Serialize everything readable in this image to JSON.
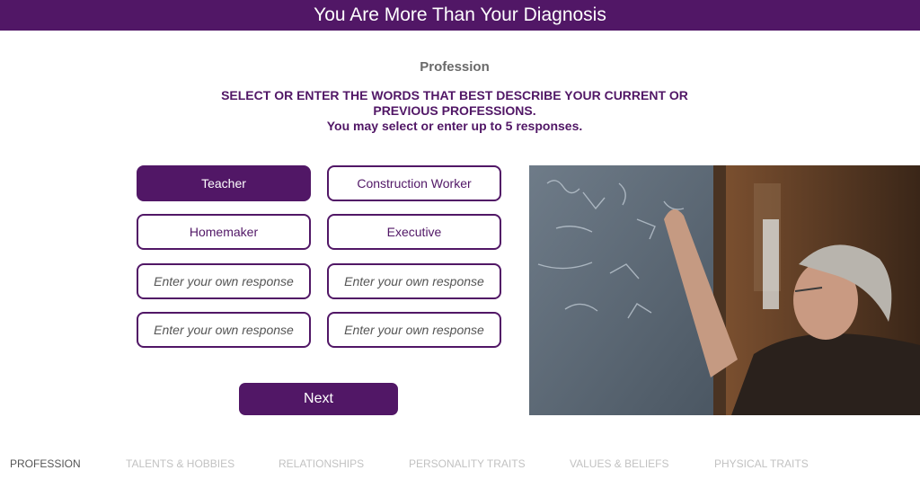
{
  "header": {
    "title": "You Are More Than Your Diagnosis"
  },
  "section": {
    "title": "Profession",
    "instruction": "SELECT OR ENTER THE WORDS THAT BEST DESCRIBE YOUR CURRENT OR PREVIOUS PROFESSIONS.",
    "hint": "You may select or enter up to 5 responses."
  },
  "options": [
    {
      "label": "Teacher",
      "selected": true
    },
    {
      "label": "Construction Worker",
      "selected": false
    },
    {
      "label": "Homemaker",
      "selected": false
    },
    {
      "label": "Executive",
      "selected": false
    }
  ],
  "custom_inputs": {
    "placeholder": "Enter your own response",
    "values": [
      "",
      "",
      "",
      ""
    ]
  },
  "next_button": {
    "label": "Next"
  },
  "tabs": [
    {
      "label": "PROFESSION",
      "active": true
    },
    {
      "label": "TALENTS & HOBBIES",
      "active": false
    },
    {
      "label": "RELATIONSHIPS",
      "active": false
    },
    {
      "label": "PERSONALITY TRAITS",
      "active": false
    },
    {
      "label": "VALUES & BELIEFS",
      "active": false
    },
    {
      "label": "PHYSICAL TRAITS",
      "active": false
    }
  ],
  "colors": {
    "brand": "#511766",
    "tab_inactive": "#c2c2c2",
    "tab_active": "#555555"
  }
}
